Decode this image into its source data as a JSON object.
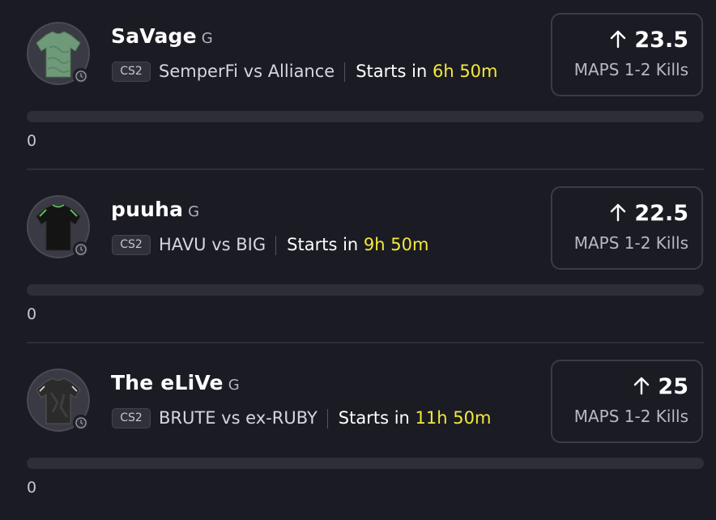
{
  "cards": [
    {
      "player": "SaVage",
      "position": "G",
      "game": "CS2",
      "matchup": "SemperFi vs Alliance",
      "starts_label": "Starts in",
      "starts_time": "6h 50m",
      "line": "23.5",
      "direction_icon": "arrow-up-icon",
      "stat": "MAPS 1-2 Kills",
      "progress": 0,
      "count": "0",
      "jersey_color": "#6f9a7a"
    },
    {
      "player": "puuha",
      "position": "G",
      "game": "CS2",
      "matchup": "HAVU vs BIG",
      "starts_label": "Starts in",
      "starts_time": "9h 50m",
      "line": "22.5",
      "direction_icon": "arrow-up-icon",
      "stat": "MAPS 1-2 Kills",
      "progress": 0,
      "count": "0",
      "jersey_color": "#141414"
    },
    {
      "player": "The eLiVe",
      "position": "G",
      "game": "CS2",
      "matchup": "BRUTE vs ex-RUBY",
      "starts_label": "Starts in",
      "starts_time": "11h 50m",
      "line": "25",
      "direction_icon": "arrow-up-icon",
      "stat": "MAPS 1-2 Kills",
      "progress": 0,
      "count": "0",
      "jersey_color": "#2b2b2b"
    }
  ],
  "colors": {
    "background": "#1b1b24",
    "accent_time": "#f3ea3a",
    "card_border": "#3c3c47",
    "track": "#2e2e38"
  }
}
